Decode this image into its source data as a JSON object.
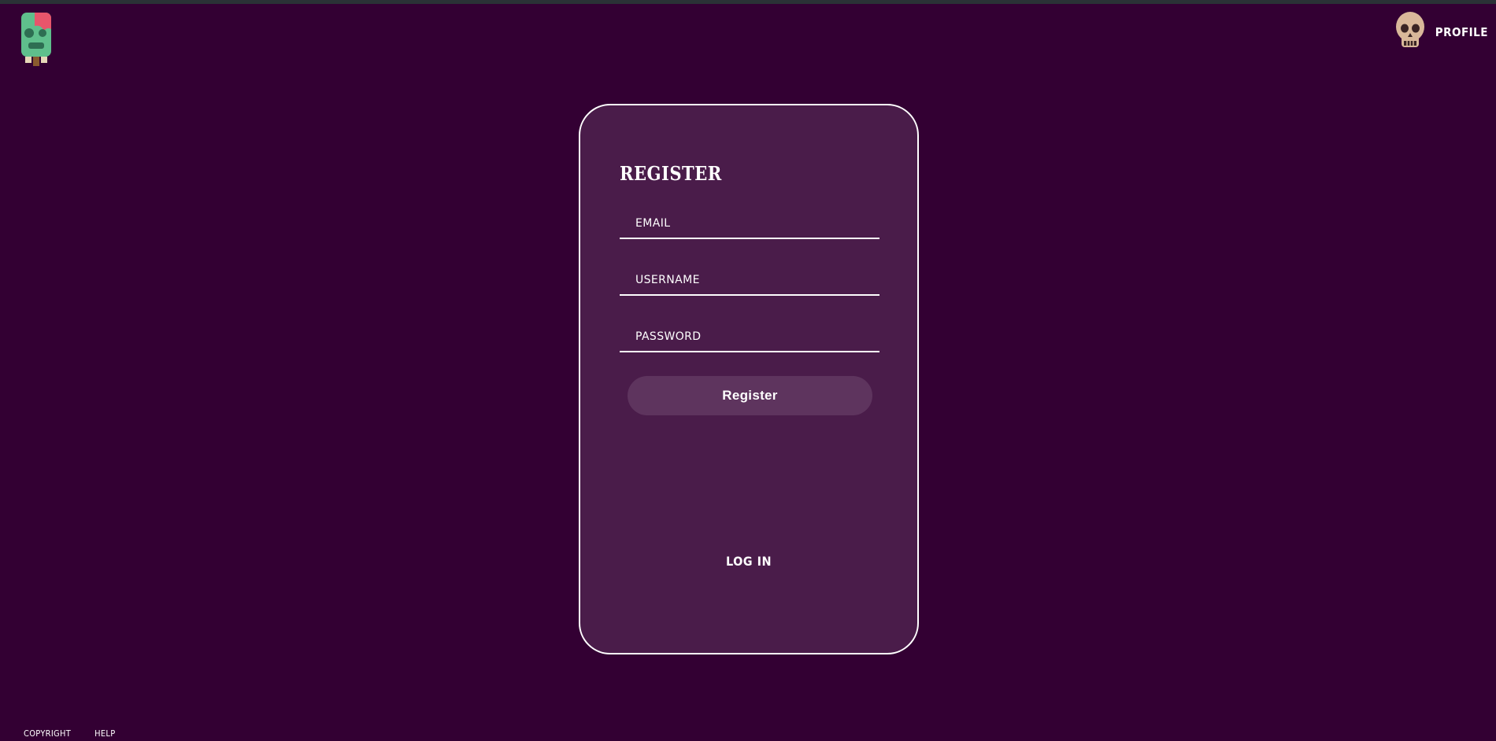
{
  "header": {
    "logo_icon": "zombie-popsicle-icon",
    "profile": {
      "icon": "skull-icon",
      "label": "Profile"
    }
  },
  "register_form": {
    "title": "Register",
    "fields": {
      "email": {
        "placeholder": "Email",
        "value": ""
      },
      "username": {
        "placeholder": "Username",
        "value": ""
      },
      "password": {
        "placeholder": "Password",
        "value": ""
      }
    },
    "submit_label": "Register",
    "login_link": "Log in"
  },
  "footer": {
    "links": [
      "Copyright",
      "Help"
    ]
  },
  "colors": {
    "page_background": "#330033",
    "card_background": "#4a1c4a",
    "button_background": "#5e345e",
    "text": "#ffffff"
  }
}
